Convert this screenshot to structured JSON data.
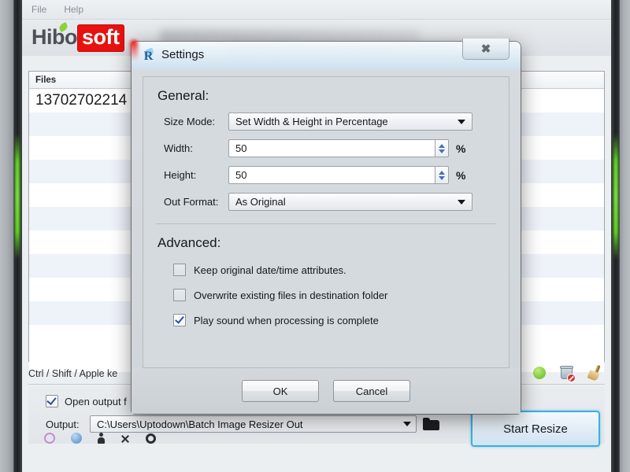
{
  "app": {
    "menu": [
      {
        "label": "File"
      },
      {
        "label": "Help"
      }
    ],
    "logo": {
      "part1": "Hibo",
      "part2": "soft"
    },
    "file_list": {
      "column_header": "Files",
      "rows": [
        {
          "name": "13702702214"
        },
        {
          "name": ""
        },
        {
          "name": ""
        },
        {
          "name": ""
        },
        {
          "name": ""
        },
        {
          "name": ""
        },
        {
          "name": ""
        },
        {
          "name": ""
        },
        {
          "name": ""
        },
        {
          "name": ""
        },
        {
          "name": ""
        },
        {
          "name": ""
        }
      ]
    },
    "hint": "Ctrl / Shift / Apple ke",
    "open_output": {
      "label": "Open output f",
      "checked": true
    },
    "output": {
      "label": "Output:",
      "value": "C:\\Users\\Uptodown\\Batch Image Resizer Out"
    },
    "start_button": "Start Resize",
    "toolbar_icons": [
      {
        "name": "add-green-icon"
      },
      {
        "name": "trash-deny-icon"
      },
      {
        "name": "broom-icon"
      }
    ],
    "bottom_icons": [
      {
        "name": "circle-outline-icon"
      },
      {
        "name": "circle-blue-icon"
      },
      {
        "name": "person-icon"
      },
      {
        "name": "close-x-icon"
      },
      {
        "name": "gear-icon"
      }
    ]
  },
  "dialog": {
    "title": "Settings",
    "icon": "R",
    "close_label": "✖",
    "general": {
      "heading": "General:",
      "size_mode": {
        "label": "Size Mode:",
        "value": "Set Width & Height in Percentage"
      },
      "width": {
        "label": "Width:",
        "value": "50",
        "unit": "%"
      },
      "height": {
        "label": "Height:",
        "value": "50",
        "unit": "%"
      },
      "out_format": {
        "label": "Out Format:",
        "value": "As Original"
      }
    },
    "advanced": {
      "heading": "Advanced:",
      "options": [
        {
          "label": "Keep original date/time attributes.",
          "checked": false
        },
        {
          "label": "Overwrite existing files in destination folder",
          "checked": false
        },
        {
          "label": "Play sound when processing is complete",
          "checked": true
        }
      ]
    },
    "buttons": {
      "ok": "OK",
      "cancel": "Cancel"
    }
  },
  "colors": {
    "brand_red": "#e8110f",
    "brand_green": "#8dd13a",
    "accent_blue": "#3bb0e0",
    "window_glow": "#5fd21f"
  }
}
